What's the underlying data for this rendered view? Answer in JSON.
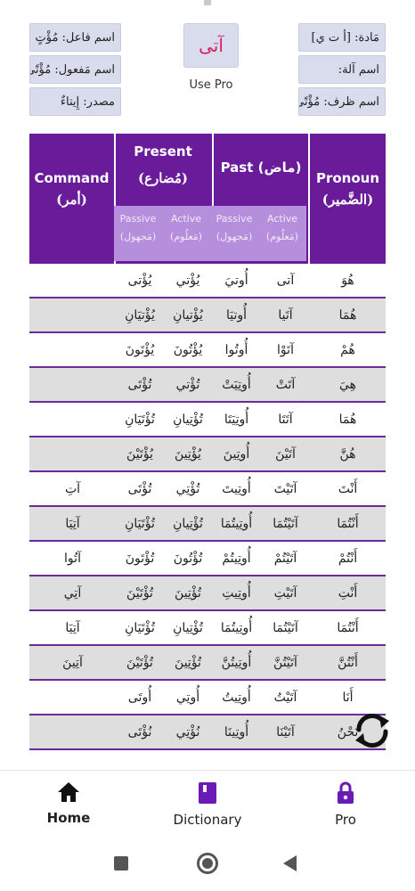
{
  "info": {
    "left": [
      "اسم فاعل: مُؤْتٍ",
      "اسم مَفعول: مُؤْتًى",
      "مصدر: إِيتاءٌ"
    ],
    "right": [
      "مَادة: [أ ت ي]",
      "اسم آلة:",
      "اسم ظرف: مُؤْتًى"
    ],
    "root": "آتى",
    "use_pro": "Use Pro"
  },
  "table": {
    "headers": {
      "command_en": "Command",
      "command_ar": "(أمر)",
      "present_en": "Present",
      "present_ar": "(مُضارع)",
      "past_en": "Past (ماض)",
      "pronoun_en": "Pronoun",
      "pronoun_ar": "(الضَّمير)"
    },
    "sub_headers": [
      {
        "en": "Passive",
        "ar": "(مَجهول)"
      },
      {
        "en": "Active",
        "ar": "(مَعلُوم)"
      },
      {
        "en": "Passive",
        "ar": "(مَجهول)"
      },
      {
        "en": "Active",
        "ar": "(مَعلُوم)"
      }
    ],
    "rows": [
      {
        "pronoun": "هُوَ",
        "past_active": "آتى",
        "past_passive": "أُوتيَ",
        "pres_active": "يُؤْتي",
        "pres_passive": "يُؤْتى",
        "command": ""
      },
      {
        "pronoun": "هُمَا",
        "past_active": "آتَيا",
        "past_passive": "أُوتيَا",
        "pres_active": "يُؤْتيانِ",
        "pres_passive": "يُؤْتيَانِ",
        "command": ""
      },
      {
        "pronoun": "هُمْ",
        "past_active": "آتَوْا",
        "past_passive": "أُوتُوا",
        "pres_active": "يُؤْتُونَ",
        "pres_passive": "يُؤْتَونَ",
        "command": ""
      },
      {
        "pronoun": "هِيَ",
        "past_active": "آتَتْ",
        "past_passive": "أُوتِيَتْ",
        "pres_active": "تُؤْتي",
        "pres_passive": "تُؤْتَى",
        "command": ""
      },
      {
        "pronoun": "هُمَا",
        "past_active": "آتَتَا",
        "past_passive": "أُوتِيَتَا",
        "pres_active": "تُؤْتِيانِ",
        "pres_passive": "تُؤْتَيَانِ",
        "command": ""
      },
      {
        "pronoun": "هُنَّ",
        "past_active": "آتَيْنَ",
        "past_passive": "أُوتِينَ",
        "pres_active": "يُؤْتِينَ",
        "pres_passive": "يُؤْتَيْنَ",
        "command": ""
      },
      {
        "pronoun": "أَنْتَ",
        "past_active": "آتَيْتَ",
        "past_passive": "أُوتِيتَ",
        "pres_active": "تُؤْتِي",
        "pres_passive": "تُؤْتَى",
        "command": "آتِ"
      },
      {
        "pronoun": "أَنْتُمَا",
        "past_active": "آتَيْتُمَا",
        "past_passive": "أُوتِيتُمَا",
        "pres_active": "تُؤْتِيانِ",
        "pres_passive": "تُؤْتَيَانِ",
        "command": "آتِيَا"
      },
      {
        "pronoun": "أَنْتُمْ",
        "past_active": "آتَيْتُمْ",
        "past_passive": "أُوتِيتُمْ",
        "pres_active": "تُؤْتُونَ",
        "pres_passive": "تُؤْتَونَ",
        "command": "آتُوا"
      },
      {
        "pronoun": "أَنْتِ",
        "past_active": "آتَيْتِ",
        "past_passive": "أُوتِيتِ",
        "pres_active": "تُؤْتِينَ",
        "pres_passive": "تُؤْتَيْنَ",
        "command": "آتِي"
      },
      {
        "pronoun": "أَنْتُمَا",
        "past_active": "آتَيْتُمَا",
        "past_passive": "أُوتِيتُمَا",
        "pres_active": "تُؤْتِيانِ",
        "pres_passive": "تُؤْتَيَانِ",
        "command": "آتِيَا"
      },
      {
        "pronoun": "أَنْتُنَّ",
        "past_active": "آتَيْتُنَّ",
        "past_passive": "أُوتِيتُنَّ",
        "pres_active": "تُؤْتِينَ",
        "pres_passive": "تُؤْتَيْنَ",
        "command": "آتِينَ"
      },
      {
        "pronoun": "أَنَا",
        "past_active": "آتَيْتُ",
        "past_passive": "أُوتِيتُ",
        "pres_active": "أُوتِي",
        "pres_passive": "أُوتَى",
        "command": ""
      },
      {
        "pronoun": "نَحْنُ",
        "past_active": "آتَيْنَا",
        "past_passive": "أُوتِينَا",
        "pres_active": "نُؤْتِي",
        "pres_passive": "نُؤْتَى",
        "command": ""
      }
    ]
  },
  "nav": {
    "home": "Home",
    "dictionary": "Dictionary",
    "pro": "Pro"
  },
  "colors": {
    "header": "#6a1b9a",
    "sub_header": "#b58fdc",
    "root_text": "#d81b60",
    "dictionary_icon": "#6a1bb5",
    "pro_icon": "#6a1bb5"
  }
}
